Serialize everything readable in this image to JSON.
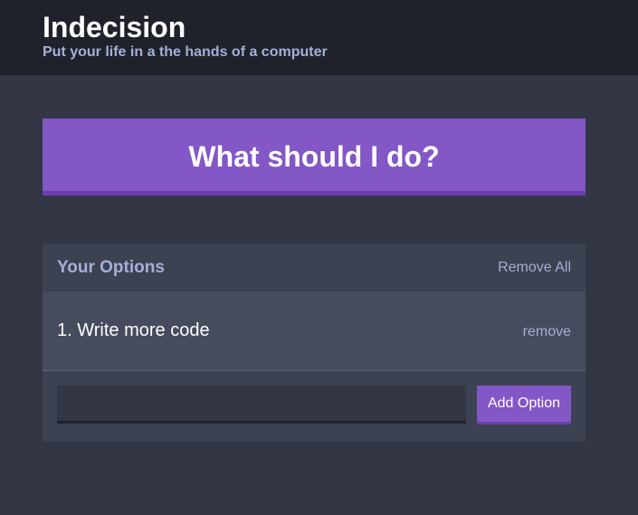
{
  "header": {
    "title": "Indecision",
    "subtitle": "Put your life in a the hands of a computer"
  },
  "action": {
    "label": "What should I do?"
  },
  "options_widget": {
    "title": "Your Options",
    "remove_all_label": "Remove All",
    "items": [
      {
        "text": "1. Write more code",
        "remove_label": "remove"
      }
    ],
    "add_input_value": "",
    "add_button_label": "Add Option"
  },
  "colors": {
    "background": "#333745",
    "header_background": "#20222b",
    "accent": "#8357c5",
    "accent_dark": "#6b3fb0",
    "muted_text": "#a5afd7",
    "widget_header": "#3c4251",
    "widget_body": "#464b5e"
  }
}
